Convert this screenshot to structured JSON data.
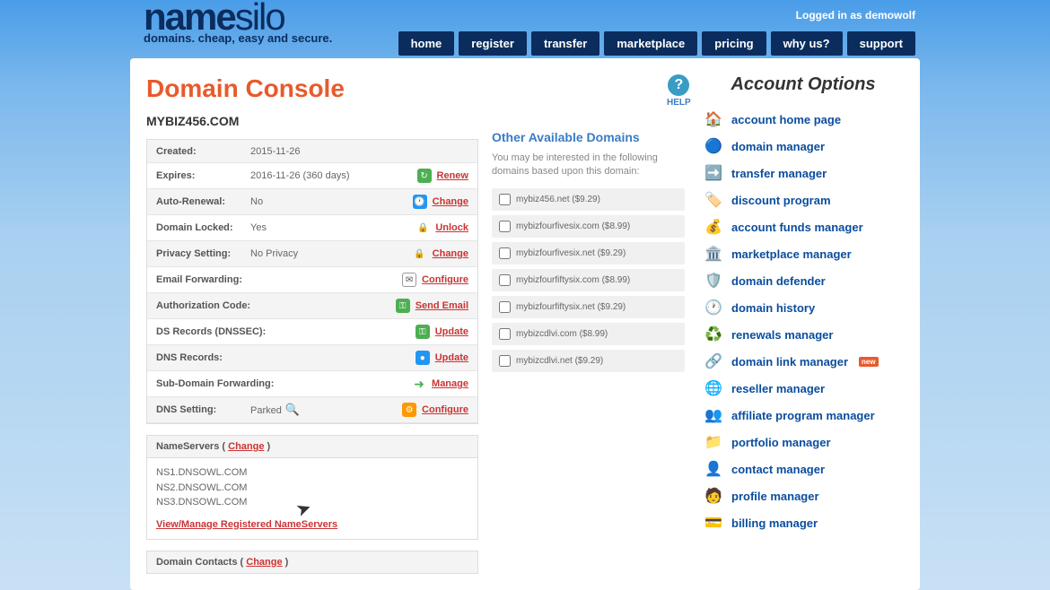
{
  "header": {
    "logo_main": "name",
    "logo_sub": "silo",
    "tagline": "domains. cheap, easy and secure.",
    "login_status": "Logged in as demowolf"
  },
  "nav": [
    {
      "label": "home"
    },
    {
      "label": "register"
    },
    {
      "label": "transfer"
    },
    {
      "label": "marketplace"
    },
    {
      "label": "pricing"
    },
    {
      "label": "why us?"
    },
    {
      "label": "support"
    }
  ],
  "page": {
    "title": "Domain Console",
    "domain": "MYBIZ456.COM",
    "help_label": "HELP"
  },
  "domain_info": [
    {
      "label": "Created:",
      "value": "2015-11-26",
      "icon": "",
      "action": ""
    },
    {
      "label": "Expires:",
      "value": "2016-11-26 (360 days)",
      "icon": "green-refresh",
      "action": "Renew"
    },
    {
      "label": "Auto-Renewal:",
      "value": "No",
      "icon": "blue-clock",
      "action": "Change"
    },
    {
      "label": "Domain Locked:",
      "value": "Yes",
      "icon": "lock",
      "action": "Unlock"
    },
    {
      "label": "Privacy Setting:",
      "value": "No Privacy",
      "icon": "lock",
      "action": "Change"
    },
    {
      "label": "Email Forwarding:",
      "value": "",
      "icon": "mail",
      "action": "Configure"
    },
    {
      "label": "Authorization Code:",
      "value": "",
      "icon": "green-key",
      "action": "Send Email"
    },
    {
      "label": "DS Records (DNSSEC):",
      "value": "",
      "icon": "green-key",
      "action": "Update"
    },
    {
      "label": "DNS Records:",
      "value": "",
      "icon": "blue-globe",
      "action": "Update"
    },
    {
      "label": "Sub-Domain Forwarding:",
      "value": "",
      "icon": "arrow",
      "action": "Manage"
    },
    {
      "label": "DNS Setting:",
      "value": "Parked",
      "icon": "gear",
      "action": "Configure",
      "magnify": true
    }
  ],
  "nameservers": {
    "header": "NameServers",
    "change": "Change",
    "servers": [
      "NS1.DNSOWL.COM",
      "NS2.DNSOWL.COM",
      "NS3.DNSOWL.COM"
    ],
    "link": "View/Manage Registered NameServers"
  },
  "contacts": {
    "header": "Domain Contacts",
    "change": "Change"
  },
  "other_domains": {
    "title": "Other Available Domains",
    "desc": "You may be interested in the following domains based upon this domain:",
    "items": [
      {
        "name": "mybiz456.net ($9.29)"
      },
      {
        "name": "mybizfourfivesix.com ($8.99)"
      },
      {
        "name": "mybizfourfivesix.net ($9.29)"
      },
      {
        "name": "mybizfourfiftysix.com ($8.99)"
      },
      {
        "name": "mybizfourfiftysix.net ($9.29)"
      },
      {
        "name": "mybizcdlvi.com ($8.99)"
      },
      {
        "name": "mybizcdlvi.net ($9.29)"
      }
    ]
  },
  "sidebar": {
    "title": "Account Options",
    "items": [
      {
        "icon": "🏠",
        "label": "account home page"
      },
      {
        "icon": "🔵",
        "label": "domain manager"
      },
      {
        "icon": "➡️",
        "label": "transfer manager"
      },
      {
        "icon": "🏷️",
        "label": "discount program"
      },
      {
        "icon": "💰",
        "label": "account funds manager"
      },
      {
        "icon": "🏛️",
        "label": "marketplace manager"
      },
      {
        "icon": "🛡️",
        "label": "domain defender"
      },
      {
        "icon": "🕐",
        "label": "domain history"
      },
      {
        "icon": "♻️",
        "label": "renewals manager"
      },
      {
        "icon": "🔗",
        "label": "domain link manager",
        "new": true
      },
      {
        "icon": "🌐",
        "label": "reseller manager"
      },
      {
        "icon": "👥",
        "label": "affiliate program manager"
      },
      {
        "icon": "📁",
        "label": "portfolio manager"
      },
      {
        "icon": "👤",
        "label": "contact manager"
      },
      {
        "icon": "🧑",
        "label": "profile manager"
      },
      {
        "icon": "💳",
        "label": "billing manager"
      }
    ]
  }
}
